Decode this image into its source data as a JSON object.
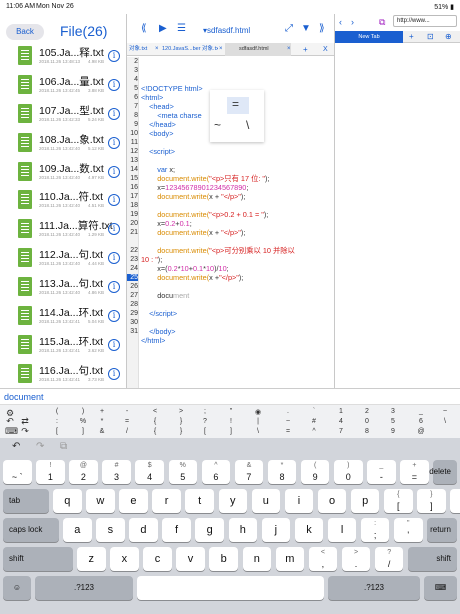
{
  "status_bar": {
    "time": "11:06 AM",
    "date": "Mon Nov 26",
    "right": "51% ▮"
  },
  "file_panel": {
    "back_label": "Back",
    "title": "File(26)",
    "items": [
      {
        "name": "105.Ja...释.txt",
        "date": "2018.11.26  13:48:13",
        "size": "4.98 KB"
      },
      {
        "name": "106.Ja...量.txt",
        "date": "2018.11.26  13:42:45",
        "size": "3.88 KB"
      },
      {
        "name": "107.Ja...型.txt",
        "date": "2018.11.26  13:42:33",
        "size": "5.24 KB"
      },
      {
        "name": "108.Ja...象.txt",
        "date": "2018.11.26  13:42:40",
        "size": "5.12 KB"
      },
      {
        "name": "109.Ja...数.txt",
        "date": "2018.11.26  13:42:40",
        "size": "4.97 KB"
      },
      {
        "name": "110.Ja...符.txt",
        "date": "2018.11.26  13:42:40",
        "size": "4.51 KB"
      },
      {
        "name": "111.Ja...算符.txt",
        "date": "2018.11.26  13:42:40",
        "size": "1.29 KB"
      },
      {
        "name": "112.Ja...句.txt",
        "date": "2018.11.26  13:42:40",
        "size": "4.44 KB"
      },
      {
        "name": "113.Ja...句.txt",
        "date": "2018.11.26  13:42:40",
        "size": "4.86 KB"
      },
      {
        "name": "114.Ja...环.txt",
        "date": "2018.11.26  13:42:41",
        "size": "5.04 KB"
      },
      {
        "name": "115.Ja...环.txt",
        "date": "2018.11.26  13:42:41",
        "size": "3.62 KB"
      },
      {
        "name": "116.Ja...句.txt",
        "date": "2018.11.26  13:42:41",
        "size": "3.73 KB"
      }
    ],
    "info_glyph": "i"
  },
  "editor": {
    "filename": "▾sdfasdf.html",
    "tools": [
      "⟪",
      "▶",
      "☰",
      "⤢",
      "▼",
      "⟫"
    ],
    "tabs": [
      {
        "label": "对象.txt",
        "active": false
      },
      {
        "label": "120.JavaS...ber 对象.txt",
        "active": false
      },
      {
        "label": "sdfasdf.html",
        "active": true
      }
    ],
    "tab_close": "×",
    "tab_add": "+",
    "tab_close_all": "X",
    "line_numbers": [
      "2",
      "3",
      "4",
      "5",
      "6",
      "7",
      "8",
      "9",
      "10",
      "11",
      "12",
      "13",
      "14",
      "15",
      "16",
      "17",
      "18",
      "19",
      "20",
      "21",
      "",
      "22",
      "23",
      "24",
      "25",
      "26",
      "27",
      "28",
      "29",
      "30",
      "31"
    ],
    "active_line": "25",
    "popup": {
      "items": [
        "=",
        "~",
        "\\"
      ],
      "code_hint": "<meta charse"
    }
  },
  "browser": {
    "url": "http://www...",
    "tab_label": "New Tab",
    "icons": [
      "‹",
      "›",
      "⇪",
      "↻",
      "⧉"
    ],
    "tab_tools": [
      "+",
      "⊡",
      "⊕"
    ]
  },
  "suggestion": "document",
  "symbols": {
    "row1": [
      "(",
      ")",
      "+",
      "-",
      "<",
      ">",
      ";",
      "\"",
      "◉",
      ".",
      "`",
      "1",
      "2",
      "3",
      "_",
      "~"
    ],
    "row2": [
      ":",
      "%",
      "*",
      "=",
      "{",
      "}",
      "?",
      "!",
      "|",
      "~",
      "#",
      "4",
      "0",
      "5",
      "6",
      "\\"
    ],
    "row3": [
      "[",
      "]",
      "&",
      "/",
      "{",
      "}",
      "[",
      "]",
      "\\",
      "=",
      "^",
      "7",
      "8",
      "9",
      "@"
    ]
  },
  "keyboard": {
    "row0": [
      {
        "up": "",
        "dn": "~\n`"
      },
      {
        "up": "!",
        "dn": "1"
      },
      {
        "up": "@",
        "dn": "2"
      },
      {
        "up": "#",
        "dn": "3"
      },
      {
        "up": "$",
        "dn": "4"
      },
      {
        "up": "%",
        "dn": "5"
      },
      {
        "up": "^",
        "dn": "6"
      },
      {
        "up": "&",
        "dn": "7"
      },
      {
        "up": "*",
        "dn": "8"
      },
      {
        "up": "(",
        "dn": "9"
      },
      {
        "up": ")",
        "dn": "0"
      },
      {
        "up": "_",
        "dn": "-"
      },
      {
        "up": "+",
        "dn": "="
      }
    ],
    "delete": "delete",
    "tab": "tab",
    "row1": [
      "q",
      "w",
      "e",
      "r",
      "t",
      "y",
      "u",
      "i",
      "o",
      "p"
    ],
    "row1_extra": [
      {
        "up": "{",
        "dn": "["
      },
      {
        "up": "}",
        "dn": "]"
      },
      {
        "up": "|",
        "dn": "\\"
      }
    ],
    "caps": "caps lock",
    "row2": [
      "a",
      "s",
      "d",
      "f",
      "g",
      "h",
      "j",
      "k",
      "l"
    ],
    "row2_extra": [
      {
        "up": ":",
        "dn": ";"
      },
      {
        "up": "\"",
        "dn": "'"
      }
    ],
    "return": "return",
    "shift_left": "shift",
    "row3": [
      "z",
      "x",
      "c",
      "v",
      "b",
      "n",
      "m"
    ],
    "row3_extra": [
      {
        "up": "<",
        "dn": ","
      },
      {
        "up": ">",
        "dn": "."
      },
      {
        "up": "?",
        "dn": "/"
      }
    ],
    "shift_right": "shift",
    "emoji": "☺",
    "num_left": ".?123",
    "num_right": ".?123",
    "hide": "⌨",
    "top_icons": [
      "↶",
      "↷",
      "⧉"
    ]
  }
}
